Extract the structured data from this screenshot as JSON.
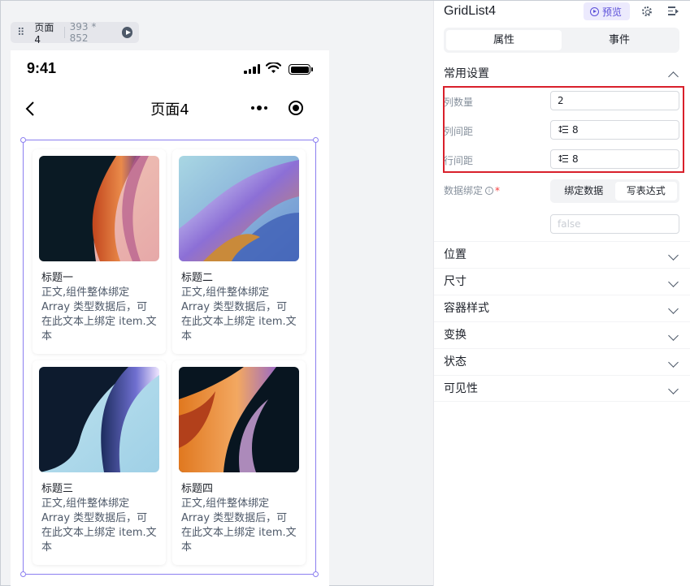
{
  "canvas": {
    "page_tag": {
      "name": "页面4",
      "size": "393 * 852"
    },
    "phone": {
      "status_time": "9:41",
      "nav_title": "页面4",
      "cards": [
        {
          "title": "标题一",
          "body": "正文,组件整体绑定 Array 类型数据后，可在此文本上绑定 item.文本",
          "image": "abstract-orange-wave"
        },
        {
          "title": "标题二",
          "body": "正文,组件整体绑定 Array 类型数据后，可在此文本上绑定 item.文本",
          "image": "abstract-iridescent-wave"
        },
        {
          "title": "标题三",
          "body": "正文,组件整体绑定 Array 类型数据后，可在此文本上绑定 item.文本",
          "image": "abstract-blue-wave"
        },
        {
          "title": "标题四",
          "body": "正文,组件整体绑定 Array 类型数据后，可在此文本上绑定 item.文本",
          "image": "abstract-orange-dark-wave"
        }
      ]
    }
  },
  "panel": {
    "component_name": "GridList4",
    "preview_label": "预览",
    "tabs": [
      {
        "label": "属性",
        "active": true
      },
      {
        "label": "事件",
        "active": false
      }
    ],
    "common": {
      "title": "常用设置",
      "columns": {
        "label": "列数量",
        "value": "2"
      },
      "column_gap": {
        "label": "列间距",
        "value": "8"
      },
      "row_gap": {
        "label": "行间距",
        "value": "8"
      },
      "data_binding": {
        "label": "数据绑定",
        "required_mark": "*",
        "info_mark": "i",
        "options": [
          "绑定数据",
          "写表达式"
        ],
        "selected": "写表达式",
        "expression_placeholder": "false"
      }
    },
    "sections": [
      "位置",
      "尺寸",
      "容器样式",
      "变换",
      "状态",
      "可见性"
    ]
  },
  "colors": {
    "selection": "#8b7ff0",
    "highlight": "#d9202b",
    "accent": "#5b4fd9"
  }
}
